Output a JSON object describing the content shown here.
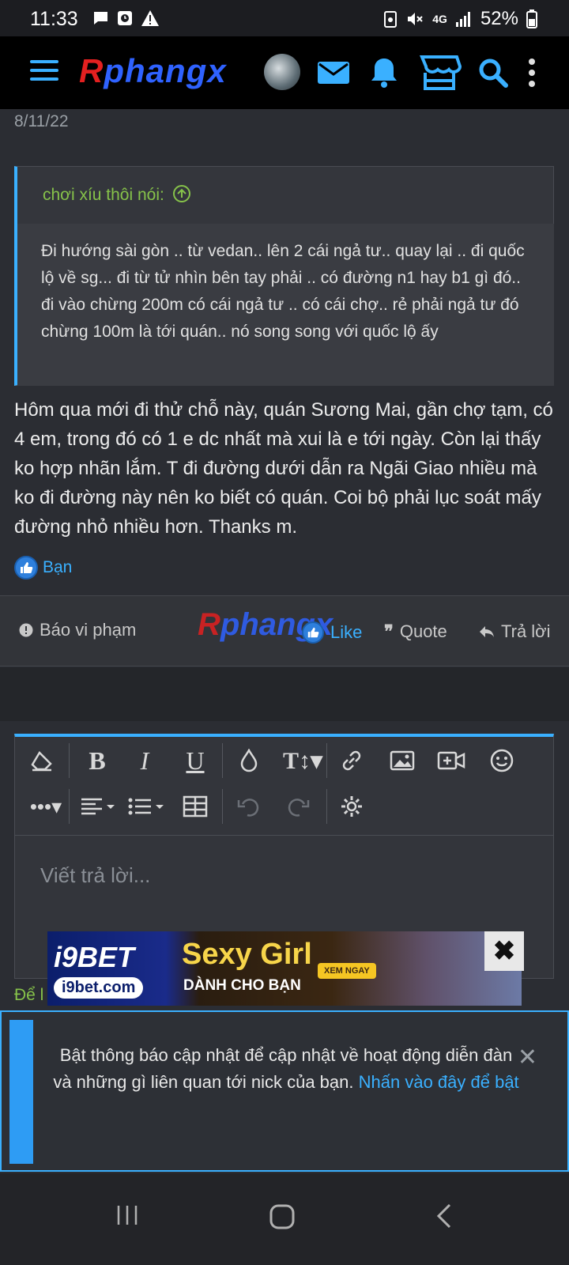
{
  "status_bar": {
    "time": "11:33",
    "network": "4G",
    "battery": "52%"
  },
  "header": {
    "logo_left": "R",
    "logo_right": "phangx",
    "icons": [
      "menu-icon",
      "avatar",
      "mail-icon",
      "bell-icon",
      "store-icon",
      "search-icon",
      "more-vertical-icon"
    ]
  },
  "post": {
    "date": "8/11/22",
    "quote_author": "chơi xíu thôi nói:",
    "quote_text": "Đi hướng sài gòn .. từ vedan.. lên 2 cái ngả tư.. quay lại .. đi quốc lộ về sg... đi từ tử nhìn bên tay phải .. có đường n1 hay b1 gì đó.. đi vào chừng 200m có cái ngả tư .. có cái chợ.. rẻ phải ngả tư đó chừng 100m là tới quán.. nó song song với quốc lộ ấy",
    "text": "Hôm qua mới đi thử chỗ này, quán Sương Mai, gần chợ tạm, có 4 em, trong đó có 1 e dc nhất mà xui là e tới ngày. Còn lại thấy ko hợp nhãn lắm. T đi đường dưới dẫn ra Ngãi Giao nhiều mà ko đi đường này nên ko biết có quán. Coi bộ phải lục soát mấy đường nhỏ nhiều hơn. Thanks m.",
    "reaction_user": "Bạn"
  },
  "actions": {
    "report": "Báo vi phạm",
    "like": "Like",
    "quote": "Quote",
    "reply": "Trả lời",
    "watermark_left": "R",
    "watermark_right": "phangx"
  },
  "editor": {
    "placeholder": "Viết trả lời...",
    "below_text": "Để l"
  },
  "ad": {
    "brand": "i9BET",
    "site": "i9bet.com",
    "title": "Sexy Girl",
    "subtitle": "DÀNH CHO BẠN",
    "cta": "XEM NGAY"
  },
  "notice": {
    "text": "Bật thông báo cập nhật để cập nhật về hoạt động diễn đàn và những gì liên quan tới nick của bạn. ",
    "link": "Nhấn vào đây để bật"
  },
  "colors": {
    "accent": "#3ab0ff",
    "quote_author": "#86c24a",
    "background": "#2b2d33"
  }
}
